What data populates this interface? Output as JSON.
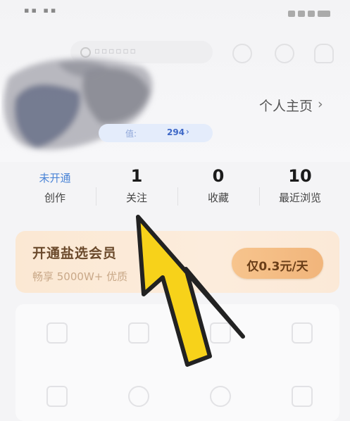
{
  "profile": {
    "profile_link_label": "个人主页",
    "value_label": "值:",
    "value_number": "294"
  },
  "stats": [
    {
      "value": "未开通",
      "label": "创作"
    },
    {
      "value": "1",
      "label": "关注"
    },
    {
      "value": "0",
      "label": "收藏"
    },
    {
      "value": "10",
      "label": "最近浏览"
    }
  ],
  "vip": {
    "title": "开通盐选会员",
    "subtitle": "畅享 5000W+ 优质",
    "button_label": "仅0.3元/天"
  },
  "colors": {
    "accent_blue": "#4a84d6",
    "vip_brown": "#6b4a2c",
    "vip_button": "#f4be86",
    "pointer_yellow": "#f7d21a"
  },
  "icons": [
    "search-icon",
    "chevron-right-icon",
    "cursor-arrow-icon"
  ]
}
